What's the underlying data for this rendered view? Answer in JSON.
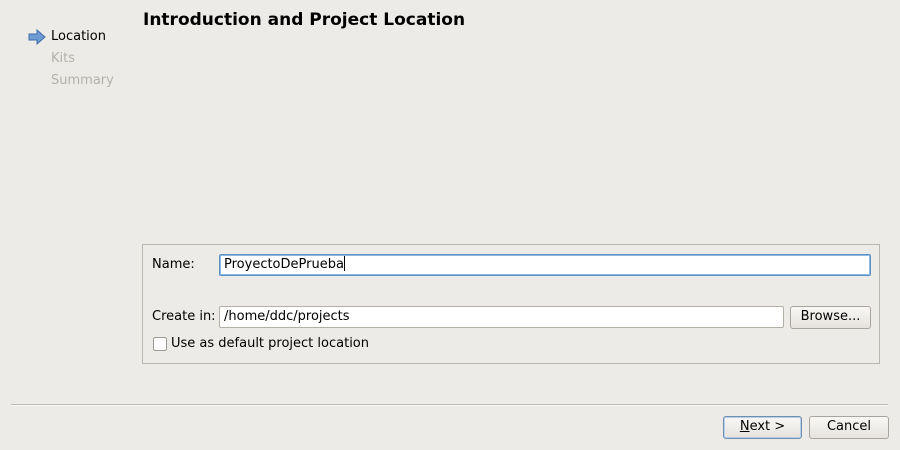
{
  "steps": [
    {
      "label": "Location",
      "state": "current"
    },
    {
      "label": "Kits",
      "state": "pending"
    },
    {
      "label": "Summary",
      "state": "pending"
    }
  ],
  "page": {
    "title": "Introduction and Project Location"
  },
  "form": {
    "name_label": "Name:",
    "name_value": "ProyectoDePrueba",
    "create_in_label": "Create in:",
    "create_in_value": "/home/ddc/projects",
    "browse_label": "Browse...",
    "default_location_label": "Use as default project location",
    "default_location_checked": false
  },
  "buttons": {
    "next_mnemonic": "N",
    "next_rest": "ext >",
    "cancel_label": "Cancel"
  },
  "icons": {
    "current_step": "arrow-right-icon"
  },
  "colors": {
    "background": "#edebe7",
    "step_arrow": "#6f9bd4",
    "inactive_text": "#b4b1ab",
    "focus_border": "#5b93c6"
  }
}
